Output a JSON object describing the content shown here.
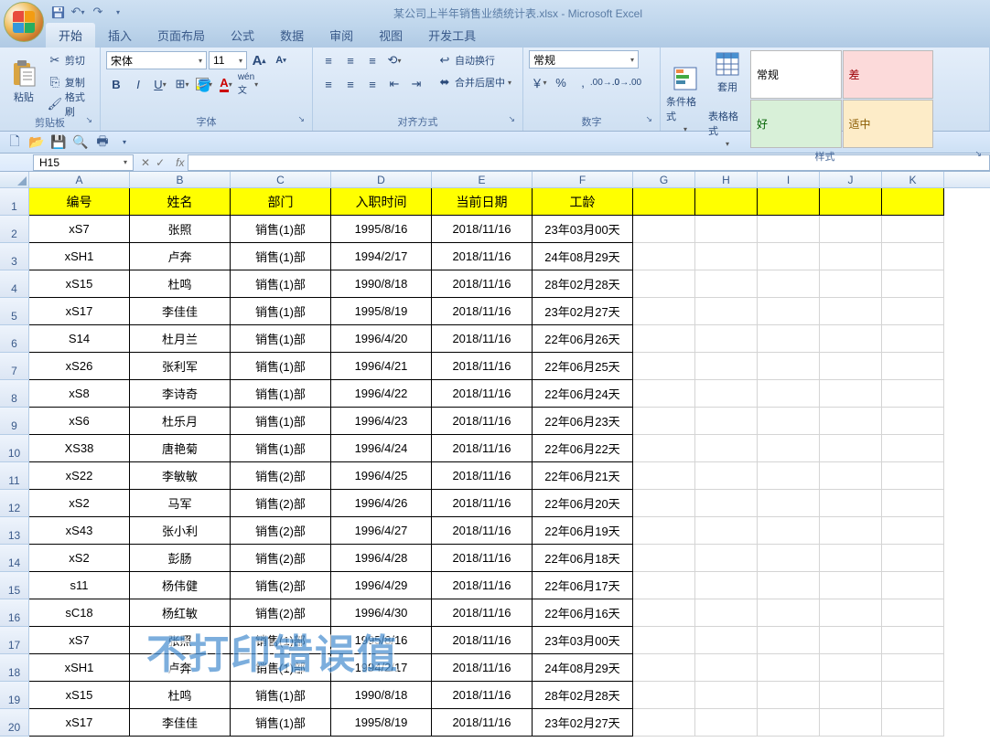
{
  "title": "某公司上半年销售业绩统计表.xlsx - Microsoft Excel",
  "qat": {
    "save": "💾",
    "undo": "↶",
    "redo": "↷"
  },
  "tabs": [
    "开始",
    "插入",
    "页面布局",
    "公式",
    "数据",
    "审阅",
    "视图",
    "开发工具"
  ],
  "active_tab": 0,
  "ribbon": {
    "clipboard": {
      "label": "剪贴板",
      "paste": "粘贴",
      "cut": "剪切",
      "copy": "复制",
      "painter": "格式刷"
    },
    "font": {
      "label": "字体",
      "name": "宋体",
      "size": "11",
      "grow": "A",
      "shrink": "A"
    },
    "align": {
      "label": "对齐方式",
      "wrap": "自动换行",
      "merge": "合并后居中"
    },
    "number": {
      "label": "数字",
      "format": "常规"
    },
    "cond": {
      "label": "条件格式"
    },
    "table": {
      "label1": "套用",
      "label2": "表格格式"
    },
    "styles": {
      "label": "样式",
      "normal": "常规",
      "bad": "差",
      "good": "好",
      "neutral": "适中"
    }
  },
  "namebox": "H15",
  "columns": [
    "A",
    "B",
    "C",
    "D",
    "E",
    "F",
    "G",
    "H",
    "I",
    "J",
    "K"
  ],
  "headers": [
    "编号",
    "姓名",
    "部门",
    "入职时间",
    "当前日期",
    "工龄"
  ],
  "rows": [
    {
      "a": "xS7",
      "b": "张照",
      "c": "销售(1)部",
      "d": "1995/8/16",
      "e": "2018/11/16",
      "f": "23年03月00天"
    },
    {
      "a": "xSH1",
      "b": "卢奔",
      "c": "销售(1)部",
      "d": "1994/2/17",
      "e": "2018/11/16",
      "f": "24年08月29天"
    },
    {
      "a": "xS15",
      "b": "杜鸣",
      "c": "销售(1)部",
      "d": "1990/8/18",
      "e": "2018/11/16",
      "f": "28年02月28天"
    },
    {
      "a": "xS17",
      "b": "李佳佳",
      "c": "销售(1)部",
      "d": "1995/8/19",
      "e": "2018/11/16",
      "f": "23年02月27天"
    },
    {
      "a": "S14",
      "b": "杜月兰",
      "c": "销售(1)部",
      "d": "1996/4/20",
      "e": "2018/11/16",
      "f": "22年06月26天"
    },
    {
      "a": "xS26",
      "b": "张利军",
      "c": "销售(1)部",
      "d": "1996/4/21",
      "e": "2018/11/16",
      "f": "22年06月25天"
    },
    {
      "a": "xS8",
      "b": "李诗奇",
      "c": "销售(1)部",
      "d": "1996/4/22",
      "e": "2018/11/16",
      "f": "22年06月24天"
    },
    {
      "a": "xS6",
      "b": "杜乐月",
      "c": "销售(1)部",
      "d": "1996/4/23",
      "e": "2018/11/16",
      "f": "22年06月23天"
    },
    {
      "a": "XS38",
      "b": "唐艳菊",
      "c": "销售(1)部",
      "d": "1996/4/24",
      "e": "2018/11/16",
      "f": "22年06月22天"
    },
    {
      "a": "xS22",
      "b": "李敏敏",
      "c": "销售(2)部",
      "d": "1996/4/25",
      "e": "2018/11/16",
      "f": "22年06月21天"
    },
    {
      "a": "xS2",
      "b": "马军",
      "c": "销售(2)部",
      "d": "1996/4/26",
      "e": "2018/11/16",
      "f": "22年06月20天"
    },
    {
      "a": "xS43",
      "b": "张小利",
      "c": "销售(2)部",
      "d": "1996/4/27",
      "e": "2018/11/16",
      "f": "22年06月19天"
    },
    {
      "a": "xS2",
      "b": "彭肠",
      "c": "销售(2)部",
      "d": "1996/4/28",
      "e": "2018/11/16",
      "f": "22年06月18天"
    },
    {
      "a": "s11",
      "b": "杨伟健",
      "c": "销售(2)部",
      "d": "1996/4/29",
      "e": "2018/11/16",
      "f": "22年06月17天"
    },
    {
      "a": "sC18",
      "b": "杨红敏",
      "c": "销售(2)部",
      "d": "1996/4/30",
      "e": "2018/11/16",
      "f": "22年06月16天"
    },
    {
      "a": "xS7",
      "b": "张照",
      "c": "销售(1)部",
      "d": "1995/8/16",
      "e": "2018/11/16",
      "f": "23年03月00天"
    },
    {
      "a": "xSH1",
      "b": "卢奔",
      "c": "销售(1)部",
      "d": "1994/2/17",
      "e": "2018/11/16",
      "f": "24年08月29天"
    },
    {
      "a": "xS15",
      "b": "杜鸣",
      "c": "销售(1)部",
      "d": "1990/8/18",
      "e": "2018/11/16",
      "f": "28年02月28天"
    },
    {
      "a": "xS17",
      "b": "李佳佳",
      "c": "销售(1)部",
      "d": "1995/8/19",
      "e": "2018/11/16",
      "f": "23年02月27天"
    }
  ],
  "watermark": "不打印错误值"
}
